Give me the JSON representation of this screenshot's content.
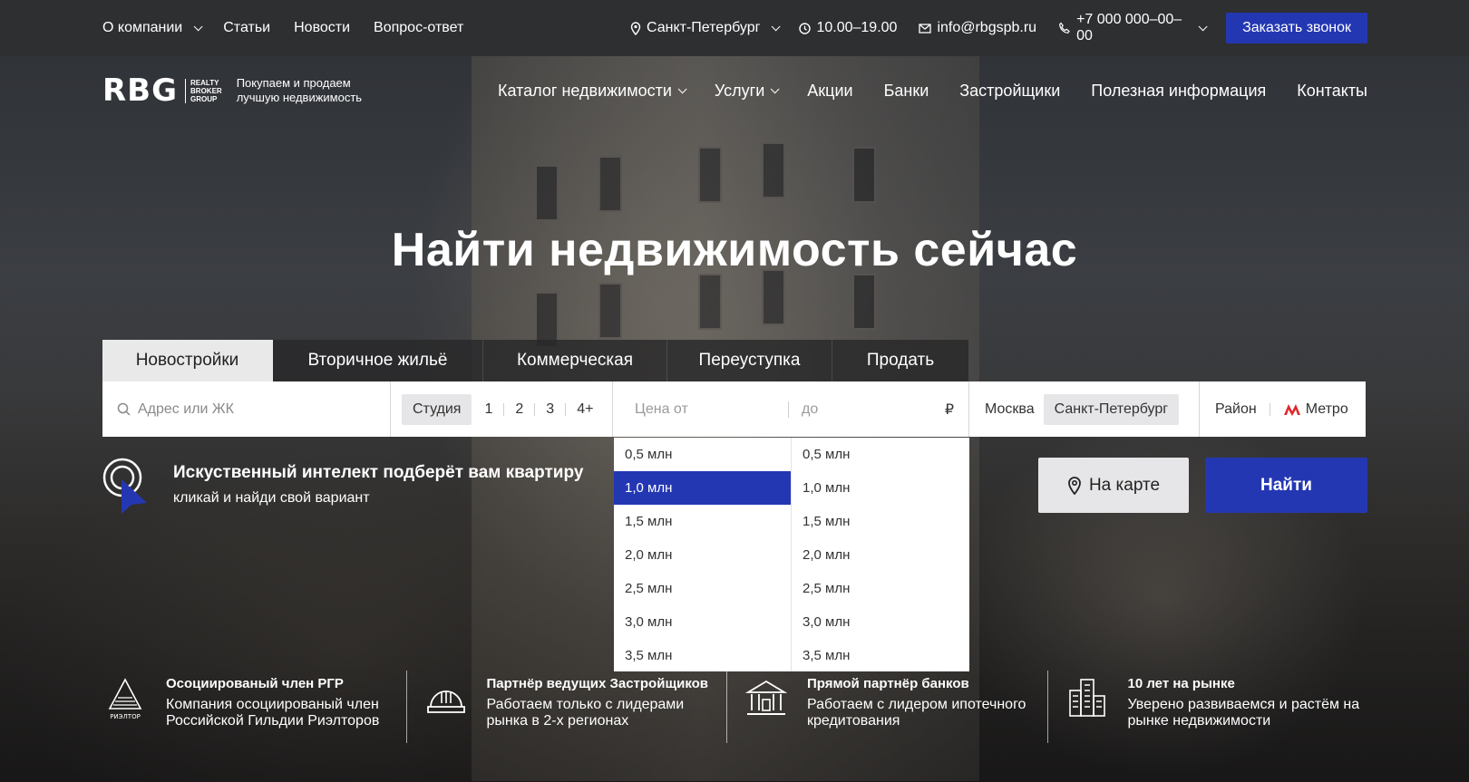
{
  "topbar": {
    "links": [
      "О компании",
      "Статьи",
      "Новости",
      "Вопрос-ответ"
    ],
    "city": "Санкт-Петербург",
    "hours": "10.00–19.00",
    "email": "info@rbgspb.ru",
    "phone": "+7 000 000–00–00",
    "call_button": "Заказать звонок"
  },
  "header": {
    "logo": "RBG",
    "logo_sub": [
      "REALTY",
      "BROKER",
      "GROUP"
    ],
    "tagline": "Покупаем и продаем лучшую недвижимость",
    "nav": [
      "Каталог недвижимости",
      "Услуги",
      "Акции",
      "Банки",
      "Застройщики",
      "Полезная информация",
      "Контакты"
    ]
  },
  "hero": {
    "title": "Найти недвижимость сейчас"
  },
  "tabs": [
    "Новостройки",
    "Вторичное жильё",
    "Коммерческая",
    "Переуступка",
    "Продать"
  ],
  "search": {
    "address_placeholder": "Адрес или ЖК",
    "rooms": [
      "Студия",
      "1",
      "2",
      "3",
      "4+"
    ],
    "price_from_placeholder": "Цена от",
    "price_to_placeholder": "до",
    "currency": "₽",
    "cities": [
      "Москва",
      "Санкт-Петербург"
    ],
    "district": "Район",
    "metro": "Метро"
  },
  "dropdown": {
    "from": [
      "0,5 млн",
      "1,0 млн",
      "1,5 млн",
      "2,0 млн",
      "2,5 млн",
      "3,0 млн",
      "3,5 млн"
    ],
    "to": [
      "0,5 млн",
      "1,0 млн",
      "1,5 млн",
      "2,0 млн",
      "2,5 млн",
      "3,0 млн",
      "3,5 млн"
    ],
    "selected_from": "1,0 млн"
  },
  "ai": {
    "title": "Искуственный интелект подберёт вам квартиру",
    "subtitle": "кликай и найди свой вариант"
  },
  "buttons": {
    "map": "На карте",
    "find": "Найти"
  },
  "features": [
    {
      "icon": "realtor-icon",
      "icon_label": "РИЭЛТОР",
      "title": "Осоциированый член РГР",
      "text": "Компания осоциированый член Российской Гильдии Риэлторов"
    },
    {
      "icon": "helmet-icon",
      "title": "Партнёр ведущих Застройщиков",
      "text": "Работаем только с лидерами рынка в 2-х регионах"
    },
    {
      "icon": "bank-icon",
      "title": "Прямой партнёр банков",
      "text": "Работаем с лидером ипотечного кредитования"
    },
    {
      "icon": "buildings-icon",
      "title": "10 лет на рынке",
      "text": "Уверено развиваемся и растём на рынке недвижимости"
    }
  ],
  "colors": {
    "accent": "#2437b3",
    "topbar": "#2e2f31",
    "metro": "#e0262b"
  }
}
